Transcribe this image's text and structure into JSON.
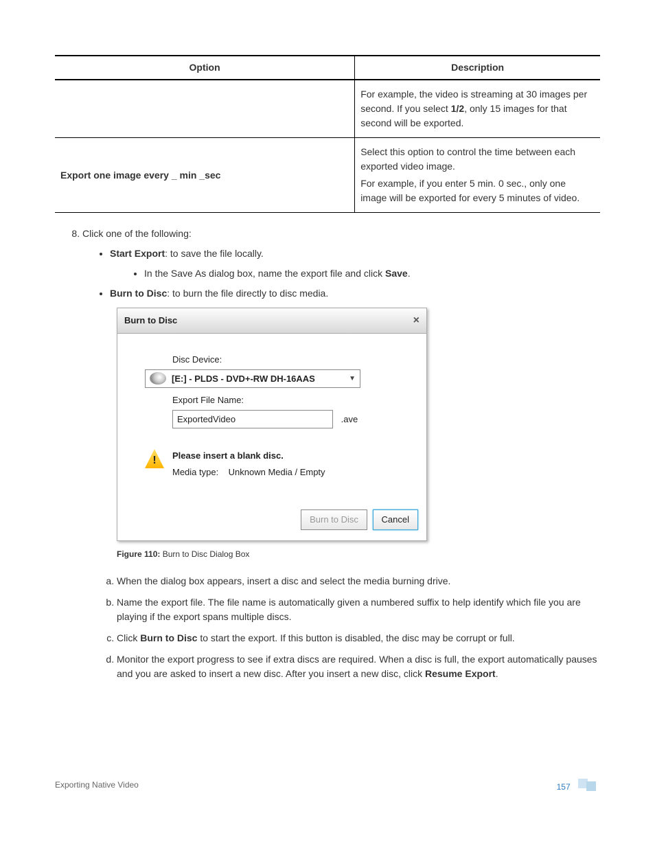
{
  "table": {
    "headers": [
      "Option",
      "Description"
    ],
    "rows": [
      {
        "option": "",
        "desc_p1": "For example, the video is streaming at 30 images per second. If you select ",
        "desc_p1_bold": "1/2",
        "desc_p1_tail": ", only 15 images for that second will be exported."
      },
      {
        "option": "Export one image every _ min _sec",
        "desc_p1": "Select this option to control the time between each exported video image.",
        "desc_p2": "For example, if you enter 5 min. 0 sec., only one image will be exported for every 5 minutes of video."
      }
    ]
  },
  "step8": {
    "number": "8.",
    "intro": "Click one of the following:",
    "start_bold": "Start Export",
    "start_tail": ": to save the file locally.",
    "start_sub_pre": "In the Save As dialog box, name the export file and click ",
    "start_sub_bold": "Save",
    "start_sub_tail": ".",
    "burn_bold": "Burn to Disc",
    "burn_tail": ": to burn the file directly to disc media."
  },
  "dialog": {
    "title": "Burn to Disc",
    "close": "×",
    "disc_label": "Disc Device:",
    "disc_value": "[E:] - PLDS - DVD+-RW DH-16AAS",
    "file_label": "Export File Name:",
    "file_value": "ExportedVideo",
    "file_ext": ".ave",
    "warn_title": "Please insert a blank disc.",
    "media_label": "Media type:",
    "media_value": "Unknown Media / Empty",
    "btn_burn": "Burn to Disc",
    "btn_cancel": "Cancel"
  },
  "figure": {
    "label": "Figure 110:",
    "caption": " Burn to Disc Dialog Box"
  },
  "substeps": {
    "a": "When the dialog box appears, insert a disc and select the media burning drive.",
    "b": "Name the export file. The file name is automatically given a numbered suffix to help identify which file you are playing if the export spans multiple discs.",
    "c_pre": "Click ",
    "c_bold": "Burn to Disc",
    "c_tail": " to start the export. If this button is disabled, the disc may be corrupt or full.",
    "d_pre": "Monitor the export progress to see if extra discs are required. When a disc is full, the export automatically pauses and you are asked to insert a new disc. After you insert a new disc, click ",
    "d_bold": "Resume Export",
    "d_tail": "."
  },
  "footer": {
    "section": "Exporting Native Video",
    "page": "157"
  }
}
